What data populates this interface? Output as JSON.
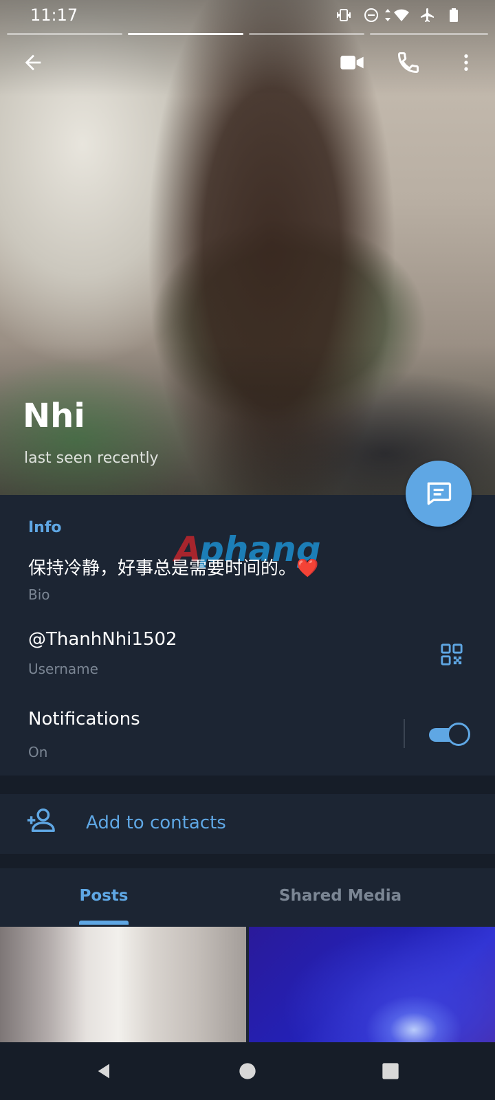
{
  "status_bar": {
    "time": "11:17",
    "icons": [
      "vibrate-icon",
      "dnd-icon",
      "data-arrows-icon",
      "wifi-icon",
      "airplane-icon",
      "battery-icon"
    ]
  },
  "story_progress": {
    "segments": 4,
    "active_segment": 2
  },
  "toolbar": {
    "icons": [
      "back-arrow-icon",
      "video-call-icon",
      "phone-icon",
      "more-vert-icon"
    ]
  },
  "profile": {
    "name": "Nhi",
    "status": "last seen recently"
  },
  "info": {
    "title": "Info",
    "bio": "保持冷静，好事总是需要时间的。❤️",
    "bio_label": "Bio",
    "username": "@ThanhNhi1502",
    "username_label": "Username",
    "notifications": "Notifications",
    "notifications_state": "On"
  },
  "actions": {
    "add_contacts": "Add to contacts"
  },
  "watermark": "Aphang",
  "tabs": [
    {
      "label": "Posts",
      "active": true
    },
    {
      "label": "Shared Media",
      "active": false
    }
  ],
  "colors": {
    "accent": "#5fa7e4",
    "background": "#1c2533",
    "separator": "#161d28"
  }
}
